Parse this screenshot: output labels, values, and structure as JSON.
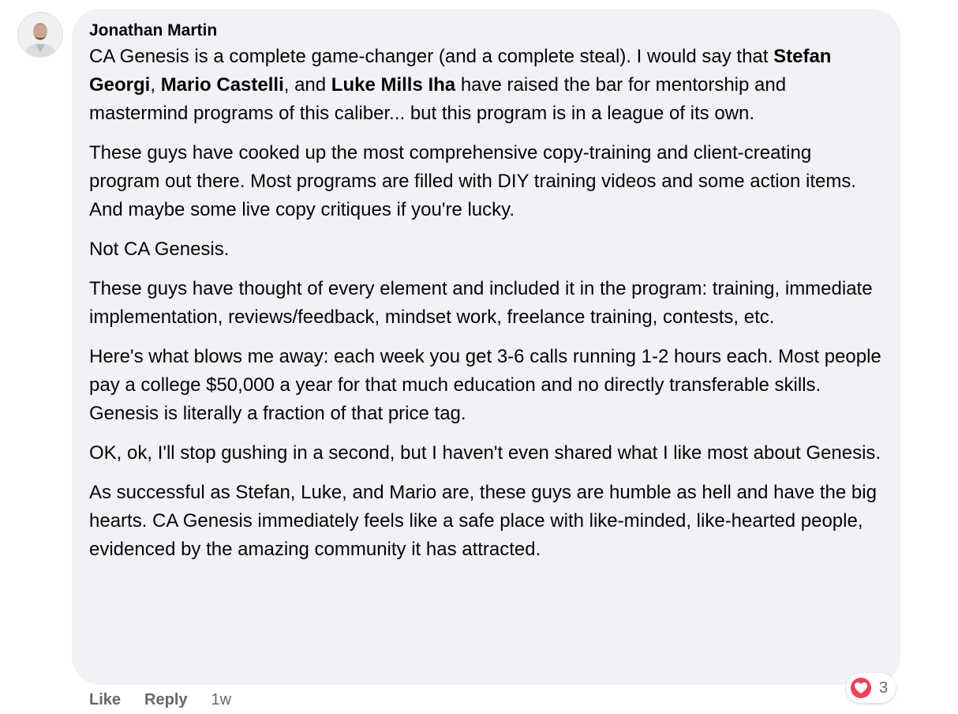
{
  "comment": {
    "author": "Jonathan Martin",
    "paragraphs": [
      {
        "segments": [
          {
            "text": "CA Genesis is a complete game-changer (and a complete steal). I would say that ",
            "bold": false
          },
          {
            "text": "Stefan Georgi",
            "bold": true
          },
          {
            "text": ", ",
            "bold": false
          },
          {
            "text": "Mario Castelli",
            "bold": true
          },
          {
            "text": ", and ",
            "bold": false
          },
          {
            "text": "Luke Mills Iha",
            "bold": true
          },
          {
            "text": " have raised the bar for mentorship and mastermind programs of this caliber... but this program is in a league of its own.",
            "bold": false
          }
        ]
      },
      {
        "segments": [
          {
            "text": "These guys have cooked up the most comprehensive copy-training and client-creating program out there. Most programs are filled with DIY training videos and some action items. And maybe some live copy critiques if you're lucky.",
            "bold": false
          }
        ]
      },
      {
        "segments": [
          {
            "text": "Not CA Genesis.",
            "bold": false
          }
        ]
      },
      {
        "segments": [
          {
            "text": "These guys have thought of every element and included it in the program: training, immediate implementation, reviews/feedback, mindset work, freelance training, contests, etc.",
            "bold": false
          }
        ]
      },
      {
        "segments": [
          {
            "text": "Here's what blows me away: each week you get 3-6 calls running 1-2 hours each. Most people pay a college $50,000 a year for that much education and no directly transferable skills. Genesis is literally a fraction of that price tag.",
            "bold": false
          }
        ]
      },
      {
        "segments": [
          {
            "text": "OK, ok, I'll stop gushing in a second, but I haven't even shared what I like most about Genesis.",
            "bold": false
          }
        ]
      },
      {
        "segments": [
          {
            "text": "As successful as Stefan, Luke, and Mario are, these guys are humble as hell and have the big hearts. CA Genesis immediately feels like a safe place with like-minded, like-hearted people, evidenced by the amazing community it has attracted.",
            "bold": false
          }
        ]
      }
    ],
    "actions": {
      "like_label": "Like",
      "reply_label": "Reply",
      "timestamp": "1w"
    },
    "reactions": {
      "icon": "heart-icon",
      "count": "3",
      "color": "#f33e58"
    }
  }
}
